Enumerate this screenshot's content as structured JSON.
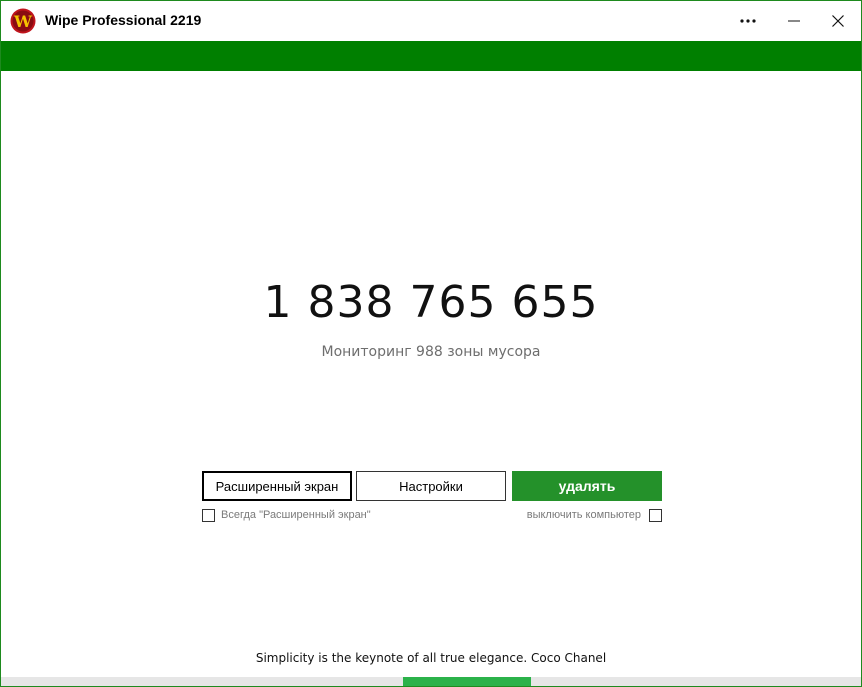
{
  "window": {
    "title": "Wipe Professional 2219",
    "logo_letter": "W"
  },
  "titlebar_buttons": {
    "more_icon": "more-dots-icon",
    "minimize_icon": "minimize-icon",
    "close_icon": "close-icon"
  },
  "main": {
    "counter": "1 838 765 655",
    "subtitle": "Мониторинг 988 зоны мусора"
  },
  "buttons": {
    "advanced_label": "Расширенный экран",
    "settings_label": "Настройки",
    "delete_label": "удалять"
  },
  "options": {
    "always_advanced_label": "Всегда \"Расширенный экран\"",
    "always_advanced_checked": false,
    "shutdown_label": "выключить компьютер",
    "shutdown_checked": false
  },
  "footer": {
    "quote": "Simplicity is the keynote of all true elegance. Coco Chanel"
  },
  "colors": {
    "accent_green": "#007f00",
    "button_green": "#24912a",
    "progress_green": "#2bb24a"
  }
}
